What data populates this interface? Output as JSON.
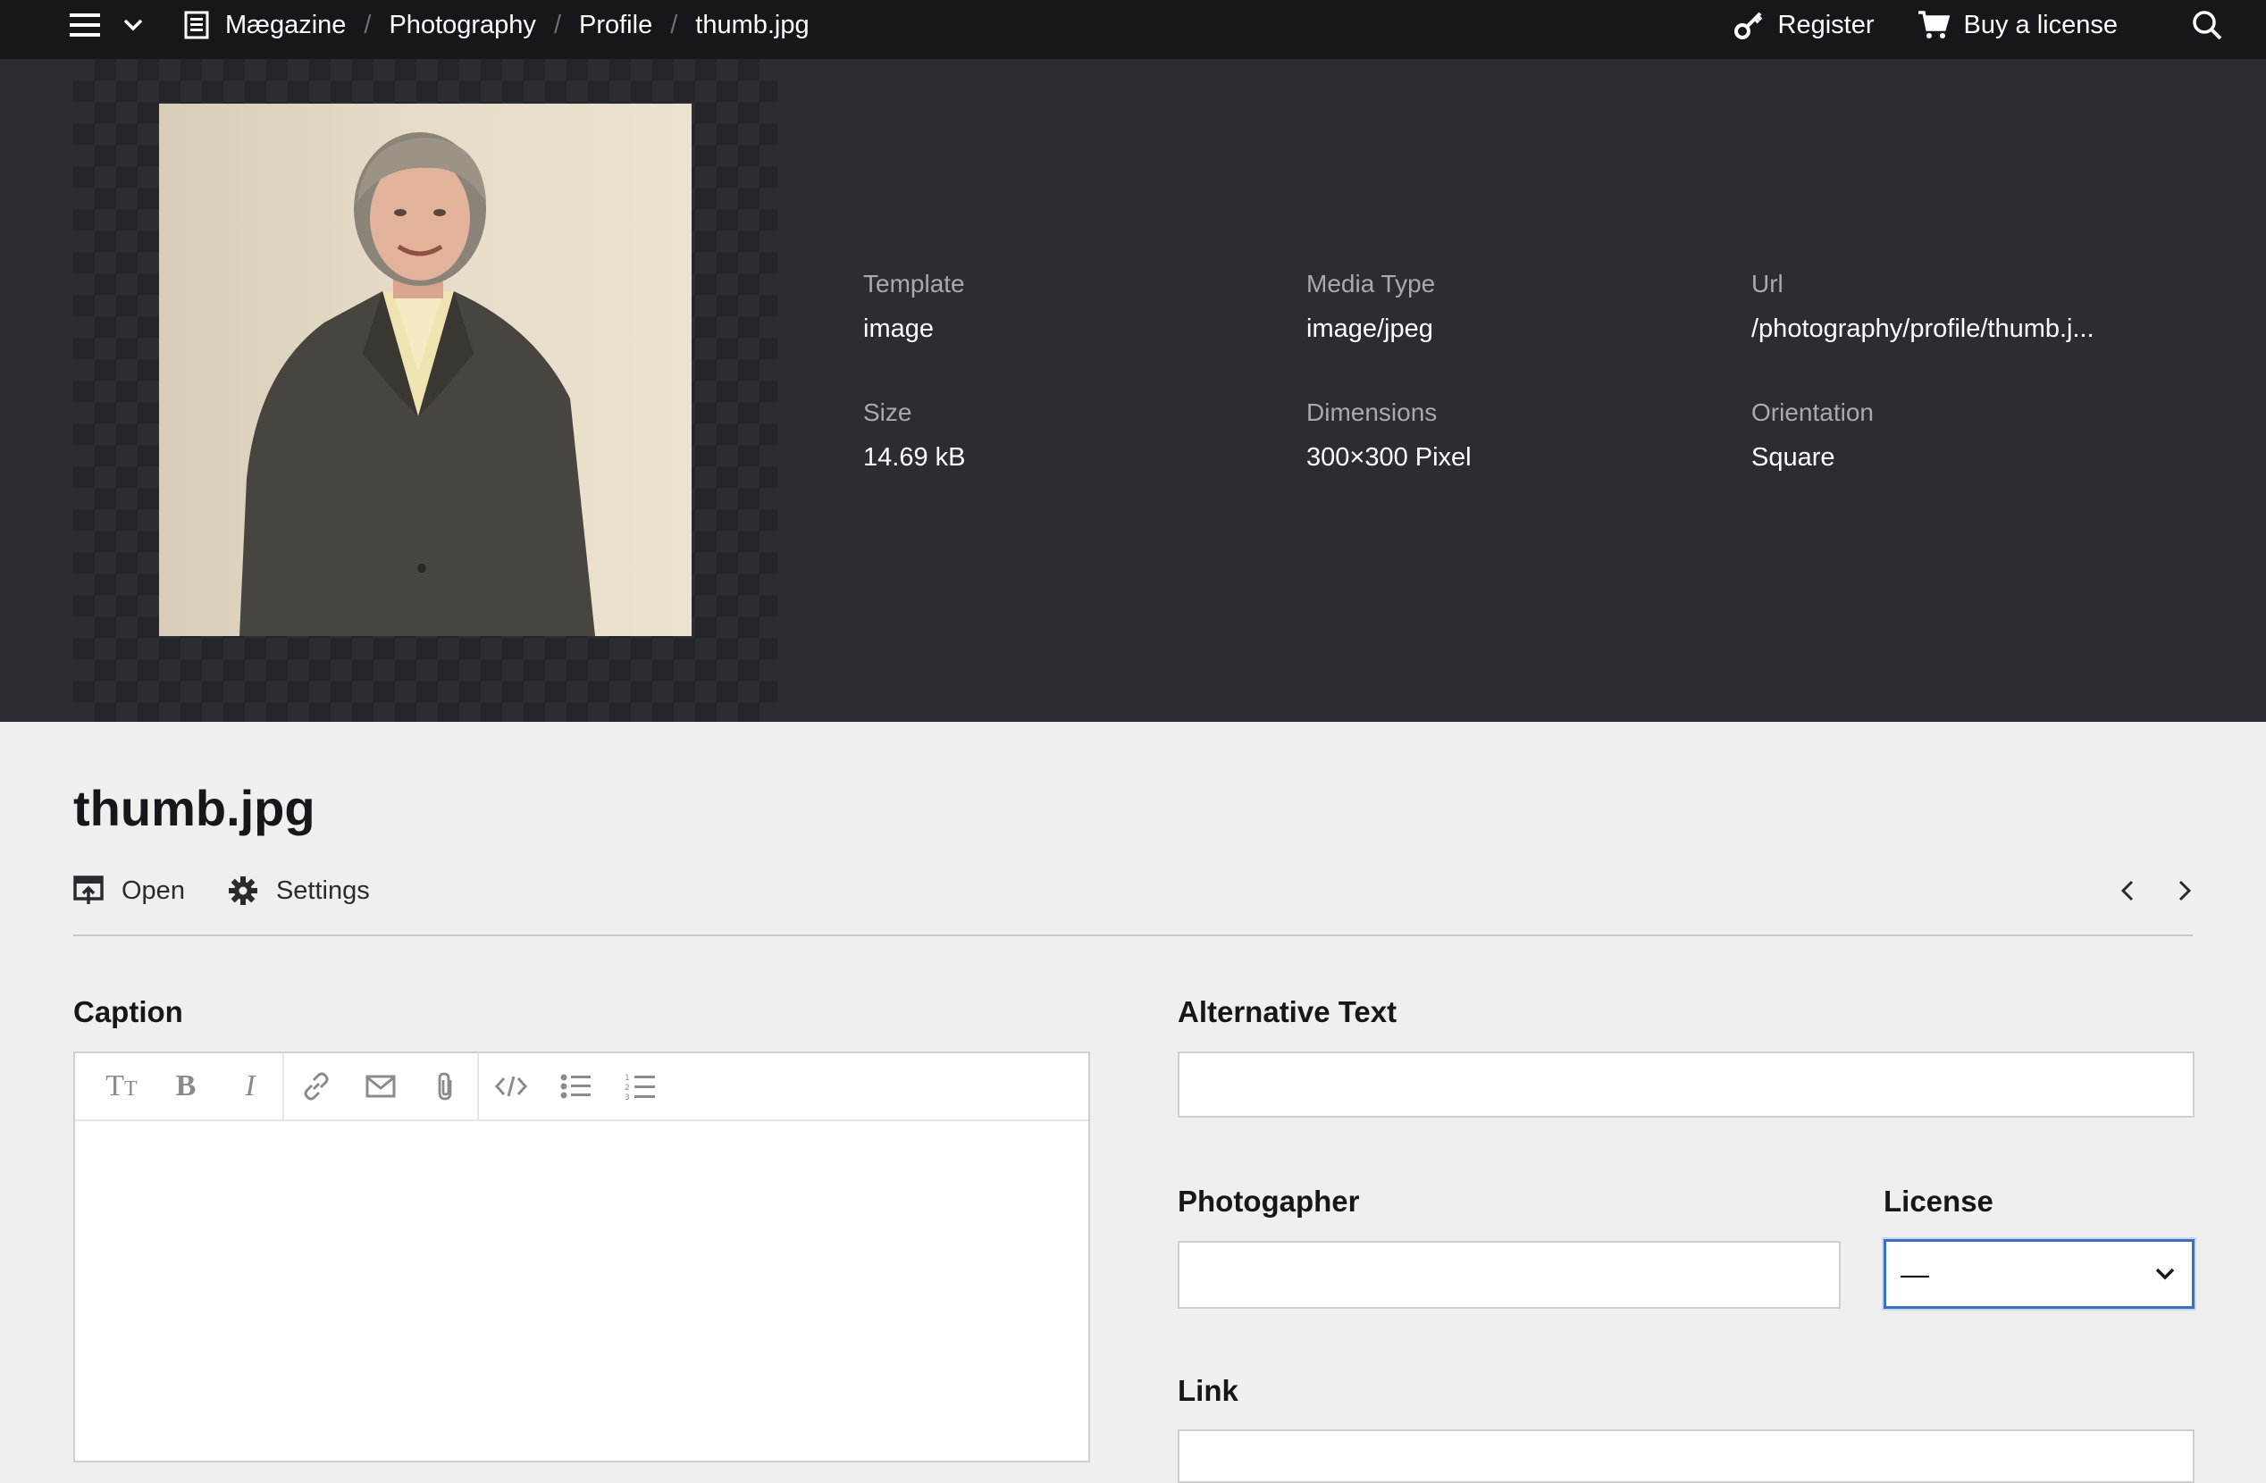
{
  "breadcrumb": [
    "Mægazine",
    "Photography",
    "Profile",
    "thumb.jpg"
  ],
  "nav": {
    "register": "Register",
    "buy": "Buy a license"
  },
  "meta": {
    "template_label": "Template",
    "template_value": "image",
    "media_type_label": "Media Type",
    "media_type_value": "image/jpeg",
    "url_label": "Url",
    "url_value": "/photography/profile/thumb.j...",
    "size_label": "Size",
    "size_value": "14.69 kB",
    "dimensions_label": "Dimensions",
    "dimensions_value": "300×300 Pixel",
    "orientation_label": "Orientation",
    "orientation_value": "Square"
  },
  "file": {
    "title": "thumb.jpg"
  },
  "actions": {
    "open": "Open",
    "settings": "Settings"
  },
  "form": {
    "caption_label": "Caption",
    "alt_label": "Alternative Text",
    "photographer_label": "Photogapher",
    "license_label": "License",
    "license_value": "—",
    "link_label": "Link"
  },
  "toolbar_icons": [
    "headings-icon",
    "bold-icon",
    "italic-icon",
    "link-icon",
    "email-icon",
    "attachment-icon",
    "code-icon",
    "bullet-list-icon",
    "ordered-list-icon"
  ],
  "colors": {
    "topbar": "#16171a",
    "preview_bg": "#2c2d33",
    "page_bg": "#efefef",
    "focus": "#3d6fbf"
  }
}
